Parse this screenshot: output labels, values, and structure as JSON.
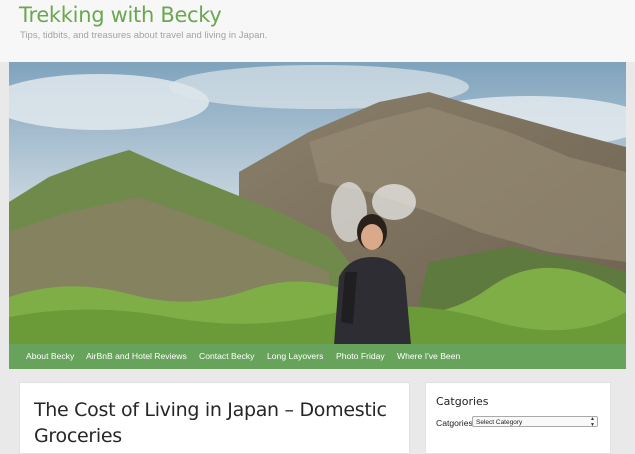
{
  "site": {
    "title": "Trekking with Becky",
    "tagline": "Tips, tidbits, and treasures about travel and living in Japan."
  },
  "hero": {
    "icon": "header-photo"
  },
  "nav": {
    "items": [
      {
        "label": "About Becky"
      },
      {
        "label": "AirBnB and Hotel Reviews"
      },
      {
        "label": "Contact Becky"
      },
      {
        "label": "Long Layovers"
      },
      {
        "label": "Photo Friday"
      },
      {
        "label": "Where I've Been"
      }
    ]
  },
  "post": {
    "title": "The Cost of Living in Japan – Domestic Groceries"
  },
  "sidebar": {
    "widget_title": "Catgories",
    "label": "Catgories",
    "select_value": "Select Category"
  },
  "colors": {
    "accent": "#6aa84f",
    "nav_bg": "#67a35a",
    "page_bg": "#e9e9e9"
  }
}
